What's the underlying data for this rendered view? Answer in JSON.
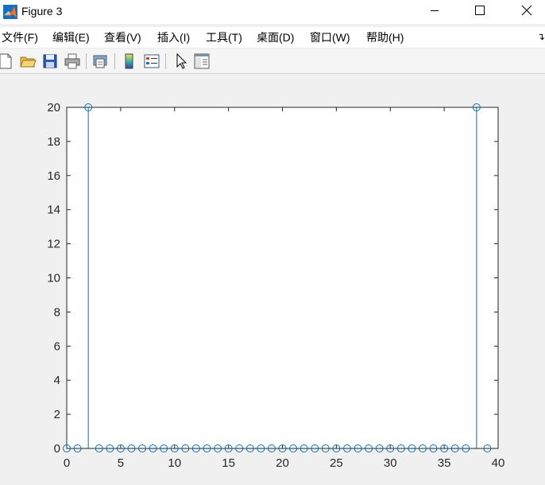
{
  "window": {
    "title": "Figure 3",
    "controls": [
      "minimize",
      "maximize",
      "close"
    ]
  },
  "menu": {
    "items": [
      "文件(F)",
      "编辑(E)",
      "查看(V)",
      "插入(I)",
      "工具(T)",
      "桌面(D)",
      "窗口(W)",
      "帮助(H)"
    ]
  },
  "toolbar": {
    "icons": [
      "new-figure-icon",
      "open-file-icon",
      "save-icon",
      "print-icon",
      "print-preview-icon",
      "colorbar-icon",
      "legend-icon",
      "pointer-icon",
      "property-inspector-icon"
    ]
  },
  "colors": {
    "stem": "#0072bd",
    "axes_background": "#ffffff",
    "figure_background": "#f0f0f0"
  },
  "chart_data": {
    "type": "stem",
    "x": [
      0,
      1,
      2,
      3,
      4,
      5,
      6,
      7,
      8,
      9,
      10,
      11,
      12,
      13,
      14,
      15,
      16,
      17,
      18,
      19,
      20,
      21,
      22,
      23,
      24,
      25,
      26,
      27,
      28,
      29,
      30,
      31,
      32,
      33,
      34,
      35,
      36,
      37,
      38,
      39
    ],
    "y": [
      0,
      0,
      20,
      0,
      0,
      0,
      0,
      0,
      0,
      0,
      0,
      0,
      0,
      0,
      0,
      0,
      0,
      0,
      0,
      0,
      0,
      0,
      0,
      0,
      0,
      0,
      0,
      0,
      0,
      0,
      0,
      0,
      0,
      0,
      0,
      0,
      0,
      0,
      20,
      0
    ],
    "xlim": [
      0,
      40
    ],
    "ylim": [
      0,
      20
    ],
    "xticks": [
      0,
      5,
      10,
      15,
      20,
      25,
      30,
      35,
      40
    ],
    "yticks": [
      0,
      2,
      4,
      6,
      8,
      10,
      12,
      14,
      16,
      18,
      20
    ],
    "marker": "circle",
    "grid": false,
    "title": "",
    "xlabel": "",
    "ylabel": ""
  }
}
